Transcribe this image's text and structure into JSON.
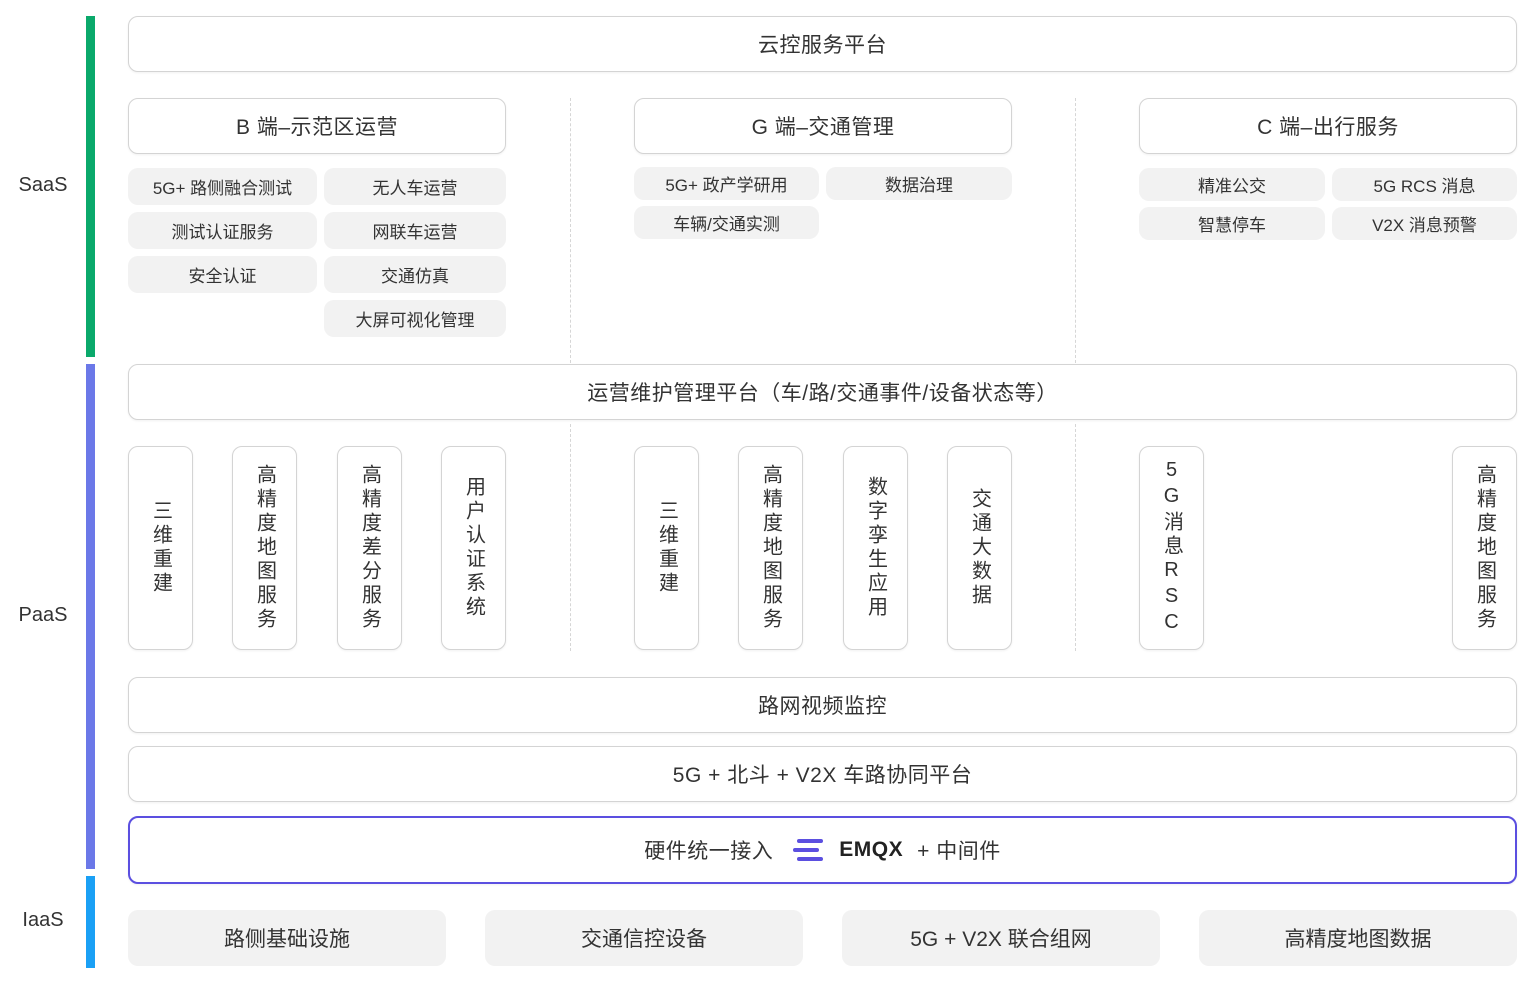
{
  "layers": {
    "saas": {
      "label": "SaaS",
      "color": "#0aa96b"
    },
    "paas": {
      "label": "PaaS",
      "color": "#6b78e8"
    },
    "iaas": {
      "label": "IaaS",
      "color": "#1aa0f5"
    }
  },
  "saas": {
    "platform": "云控服务平台",
    "b_header": "B 端–示范区运营",
    "g_header": "G 端–交通管理",
    "c_header": "C 端–出行服务",
    "b_items": [
      "5G+ 路侧融合测试",
      "无人车运营",
      "测试认证服务",
      "网联车运营",
      "安全认证",
      "交通仿真",
      "大屏可视化管理"
    ],
    "g_items": [
      "5G+ 政产学研用",
      "数据治理",
      "车辆/交通实测"
    ],
    "c_items": [
      "精准公交",
      "5G RCS 消息",
      "智慧停车",
      "V2X 消息预警"
    ]
  },
  "paas": {
    "ops_platform": "运营维护管理平台（车/路/交通事件/设备状态等）",
    "b_modules": [
      "三维重建",
      "高精度地图服务",
      "高精度差分服务",
      "用户认证系统"
    ],
    "g_modules": [
      "三维重建",
      "高精度地图服务",
      "数字孪生应用",
      "交通大数据"
    ],
    "c_modules": [
      "5G消息RSC",
      "高精度地图服务"
    ],
    "video": "路网视频监控",
    "v2x_platform": "5G + 北斗 + V2X 车路协同平台",
    "hw_access": "硬件统一接入",
    "emqx_name": "EMQX",
    "middleware": "+ 中间件",
    "emqx_color": "#5b4fe0"
  },
  "iaas": {
    "items": [
      "路侧基础设施",
      "交通信控设备",
      "5G + V2X 联合组网",
      "高精度地图数据"
    ]
  }
}
